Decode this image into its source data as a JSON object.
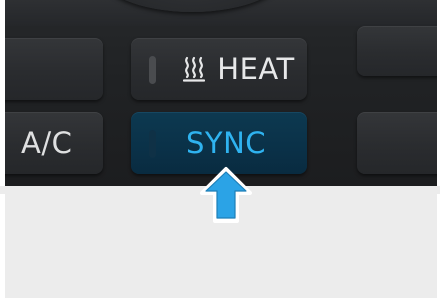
{
  "buttons": {
    "heat": {
      "label": "HEAT",
      "icon": "heater-icon"
    },
    "ac": {
      "label": "A/C"
    },
    "sync": {
      "label": "SYNC",
      "active": true
    }
  },
  "colors": {
    "panel": "#202224",
    "button": "#2e3033",
    "sync_button": "#0b344b",
    "sync_text": "#2fb3f0",
    "label_text": "#e7e8e9",
    "arrow_fill": "#2ba3e6",
    "background": "#ffffff"
  },
  "annotation": {
    "icon": "up-arrow-icon"
  }
}
